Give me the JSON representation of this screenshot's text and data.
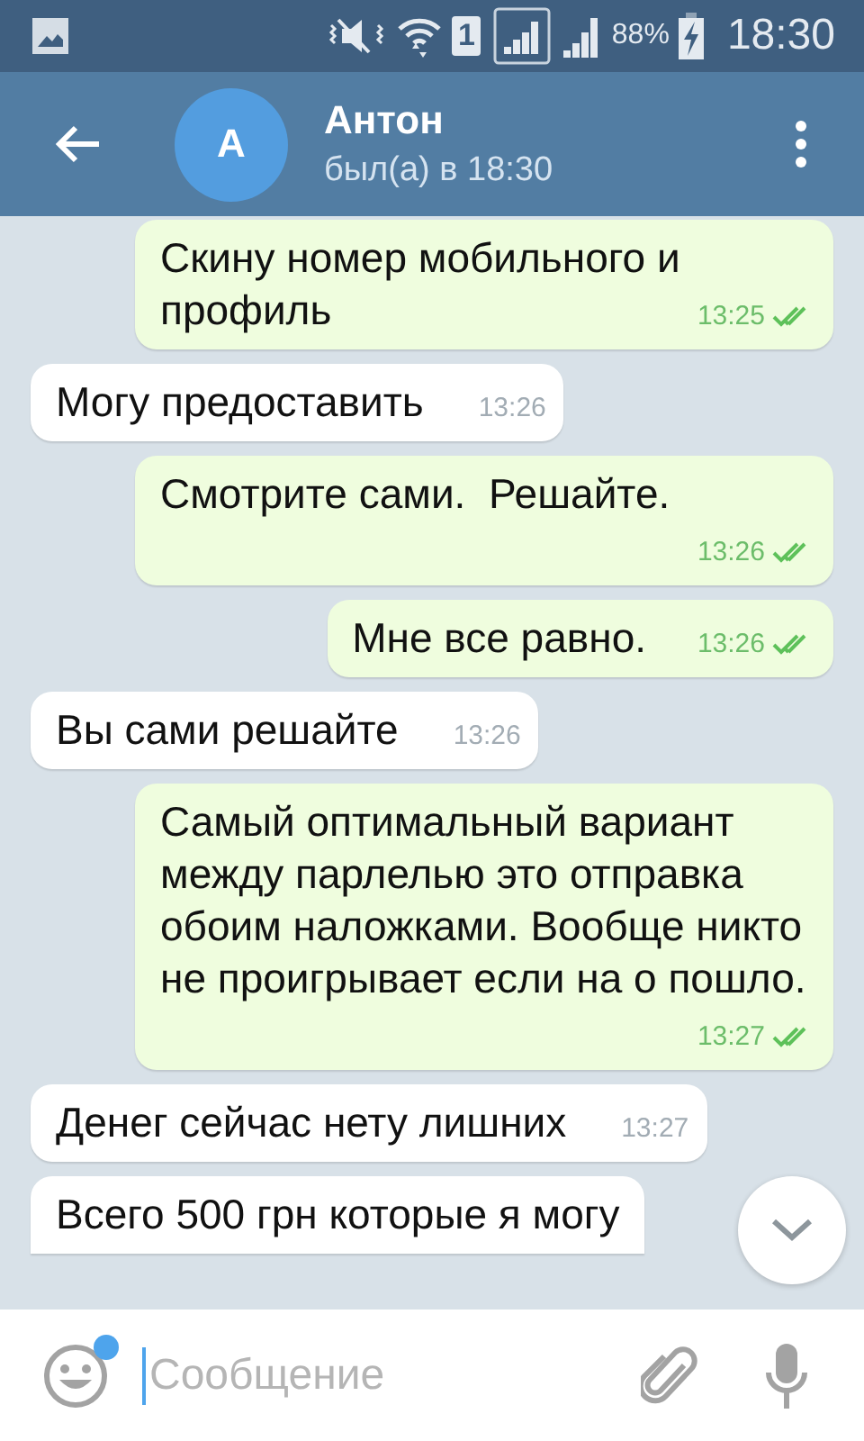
{
  "status_bar": {
    "battery": "88%",
    "time": "18:30",
    "sim": "1"
  },
  "header": {
    "avatar_letter": "А",
    "name": "Антон",
    "status": "был(а) в 18:30"
  },
  "messages": [
    {
      "kind": "out",
      "text": "Скину номер мобильного и профиль",
      "time": "13:25",
      "read": true
    },
    {
      "kind": "in",
      "text": "Могу предоставить",
      "time": "13:26"
    },
    {
      "kind": "out",
      "text": "Смотрите сами.  Решайте.",
      "time": "13:26",
      "read": true
    },
    {
      "kind": "out",
      "text": "Мне все равно.",
      "time": "13:26",
      "read": true
    },
    {
      "kind": "in",
      "text": "Вы сами решайте",
      "time": "13:26"
    },
    {
      "kind": "out",
      "text": "Самый оптимальный вариант между парлелью это отправка обоим наложками. Вообще никто не проигрывает если на о пошло.",
      "time": "13:27",
      "read": true
    },
    {
      "kind": "in",
      "text": "Денег сейчас нету лишних",
      "time": "13:27"
    },
    {
      "kind": "in",
      "text": "Всего 500 грн которые я могу"
    }
  ],
  "composer": {
    "placeholder": "Сообщение",
    "emoji_badge": true
  }
}
